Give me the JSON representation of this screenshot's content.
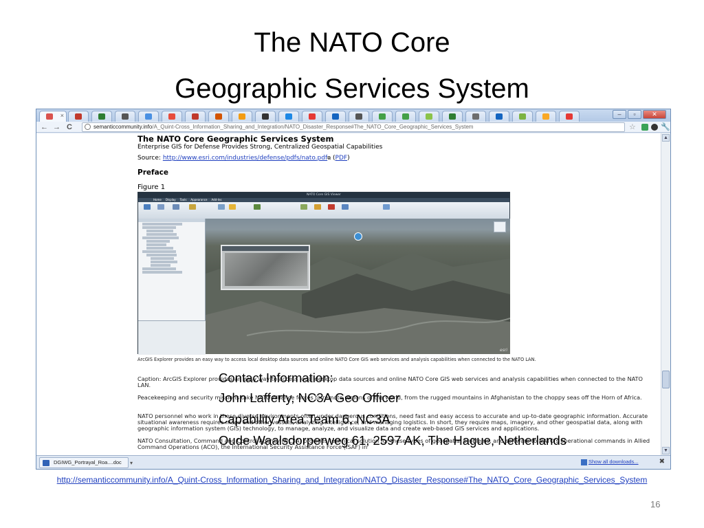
{
  "slide": {
    "title_line1": "The NATO Core",
    "title_line2": "Geographic Services System",
    "page_number": "16",
    "footer_url": "http://semanticcommunity.info/A_Quint-Cross_Information_Sharing_and_Integration/NATO_Disaster_Response#The_NATO_Core_Geographic_Services_System"
  },
  "browser": {
    "url_domain": "semanticcommunity.info",
    "url_path": "/A_Quint-Cross_Information_Sharing_and_Integration/NATO_Disaster_Response#The_NATO_Core_Geographic_Services_System",
    "nav_back_icon": "back-arrow-icon",
    "nav_forward_icon": "forward-arrow-icon",
    "reload_label": "C",
    "tab_fav_colors": [
      "#d9534f",
      "#c0392b",
      "#2e7d32",
      "#555555",
      "#4a90e2",
      "#e74c3c",
      "#c0392b",
      "#d35400",
      "#f39c12",
      "#333333",
      "#1e88e5",
      "#e53935",
      "#1565c0",
      "#555555",
      "#43a047",
      "#43a047",
      "#8bc34a",
      "#2e7d32",
      "#6d6d6d",
      "#1565c0",
      "#7cb342",
      "#f9a825",
      "#e53935"
    ],
    "accent_color": "#6f8fb8"
  },
  "page": {
    "heading": "The NATO Core Geographic Services System",
    "subtitle": "Enterprise GIS for Defense Provides Strong, Centralized Geospatial Capabilities",
    "source_prefix": "Source: ",
    "source_link": "http://www.esri.com/industries/defense/pdfs/nato.pdf",
    "source_pdf_paren_open": " (",
    "source_pdf": "PDF",
    "source_pdf_paren_close": ")",
    "preface": "Preface",
    "figure_label": "Figure 1",
    "app_window_title": "NATO Core GIS Viewer",
    "app_tabs": [
      "Home",
      "Display",
      "Tools",
      "Appearance",
      "Add-Ins"
    ],
    "overlay_title": "AC-130 Gunship",
    "map_logo": "esri",
    "caption_small": "ArcGIS Explorer provides an easy way to access local desktop data sources and online NATO Core GIS web services and analysis capabilities when connected to the NATO LAN.",
    "caption": "Caption: ArcGIS Explorer provides an easy way to access local desktop data sources and online NATO Core GIS web services and analysis capabilities when connected to the NATO LAN.",
    "para1": "Peacekeeping and security missions take NATO Alliance forces to remote regions of the world, from the rugged mountains in Afghanistan to the choppy seas off the Horn of Africa.",
    "para2": "NATO personnel who work in these diverse environments often under dangerous conditions, need fast and easy access to accurate and up-to-date geographic information. Accurate situational awareness requires maps and other vessels, analyzing intelligence, and managing logistics. In short, they require maps, imagery, and other geospatial data, along with geographic information system (GIS) technology, to manage, analyze, and visualize data and create web-based GIS services and applications.",
    "para3": "NATO Consultation, Command and Control Agency (NC3A) provides technical solution for these types of geospatial problems, and software to NATO's operational commands in Allied Command Operations (ACO), the International Security Assistance Force (ISAF) in"
  },
  "downloads": {
    "item_label": "DGIWG_Portrayal_Roa....doc",
    "show_all": "Show all downloads...",
    "close_label": "✖"
  },
  "contact": {
    "line1": "Contact Information:",
    "line2": "John Lafferty, NC3A Geo Officer",
    "line3": "Capability Area Team 6, NC3A",
    "line4": "Oude Waalsdorperweg 61, 2597 AK, The Hague, Netherlands"
  }
}
